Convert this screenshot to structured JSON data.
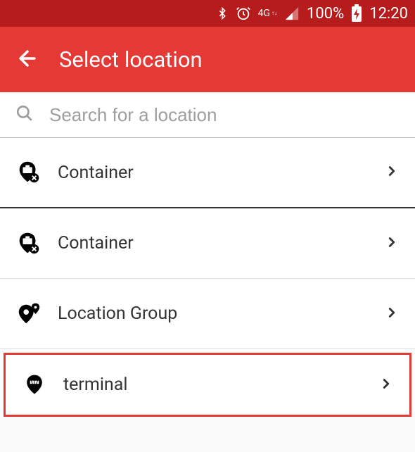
{
  "status": {
    "network_label": "4G",
    "battery_text": "100%",
    "time": "12:20"
  },
  "header": {
    "title": "Select location"
  },
  "search": {
    "placeholder": "Search for a location",
    "value": ""
  },
  "items": [
    {
      "label": "Container",
      "icon": "container-pin"
    },
    {
      "label": "Container",
      "icon": "container-pin"
    },
    {
      "label": "Location Group",
      "icon": "location-group-pin"
    },
    {
      "label": "terminal",
      "icon": "terminal-pin"
    }
  ]
}
